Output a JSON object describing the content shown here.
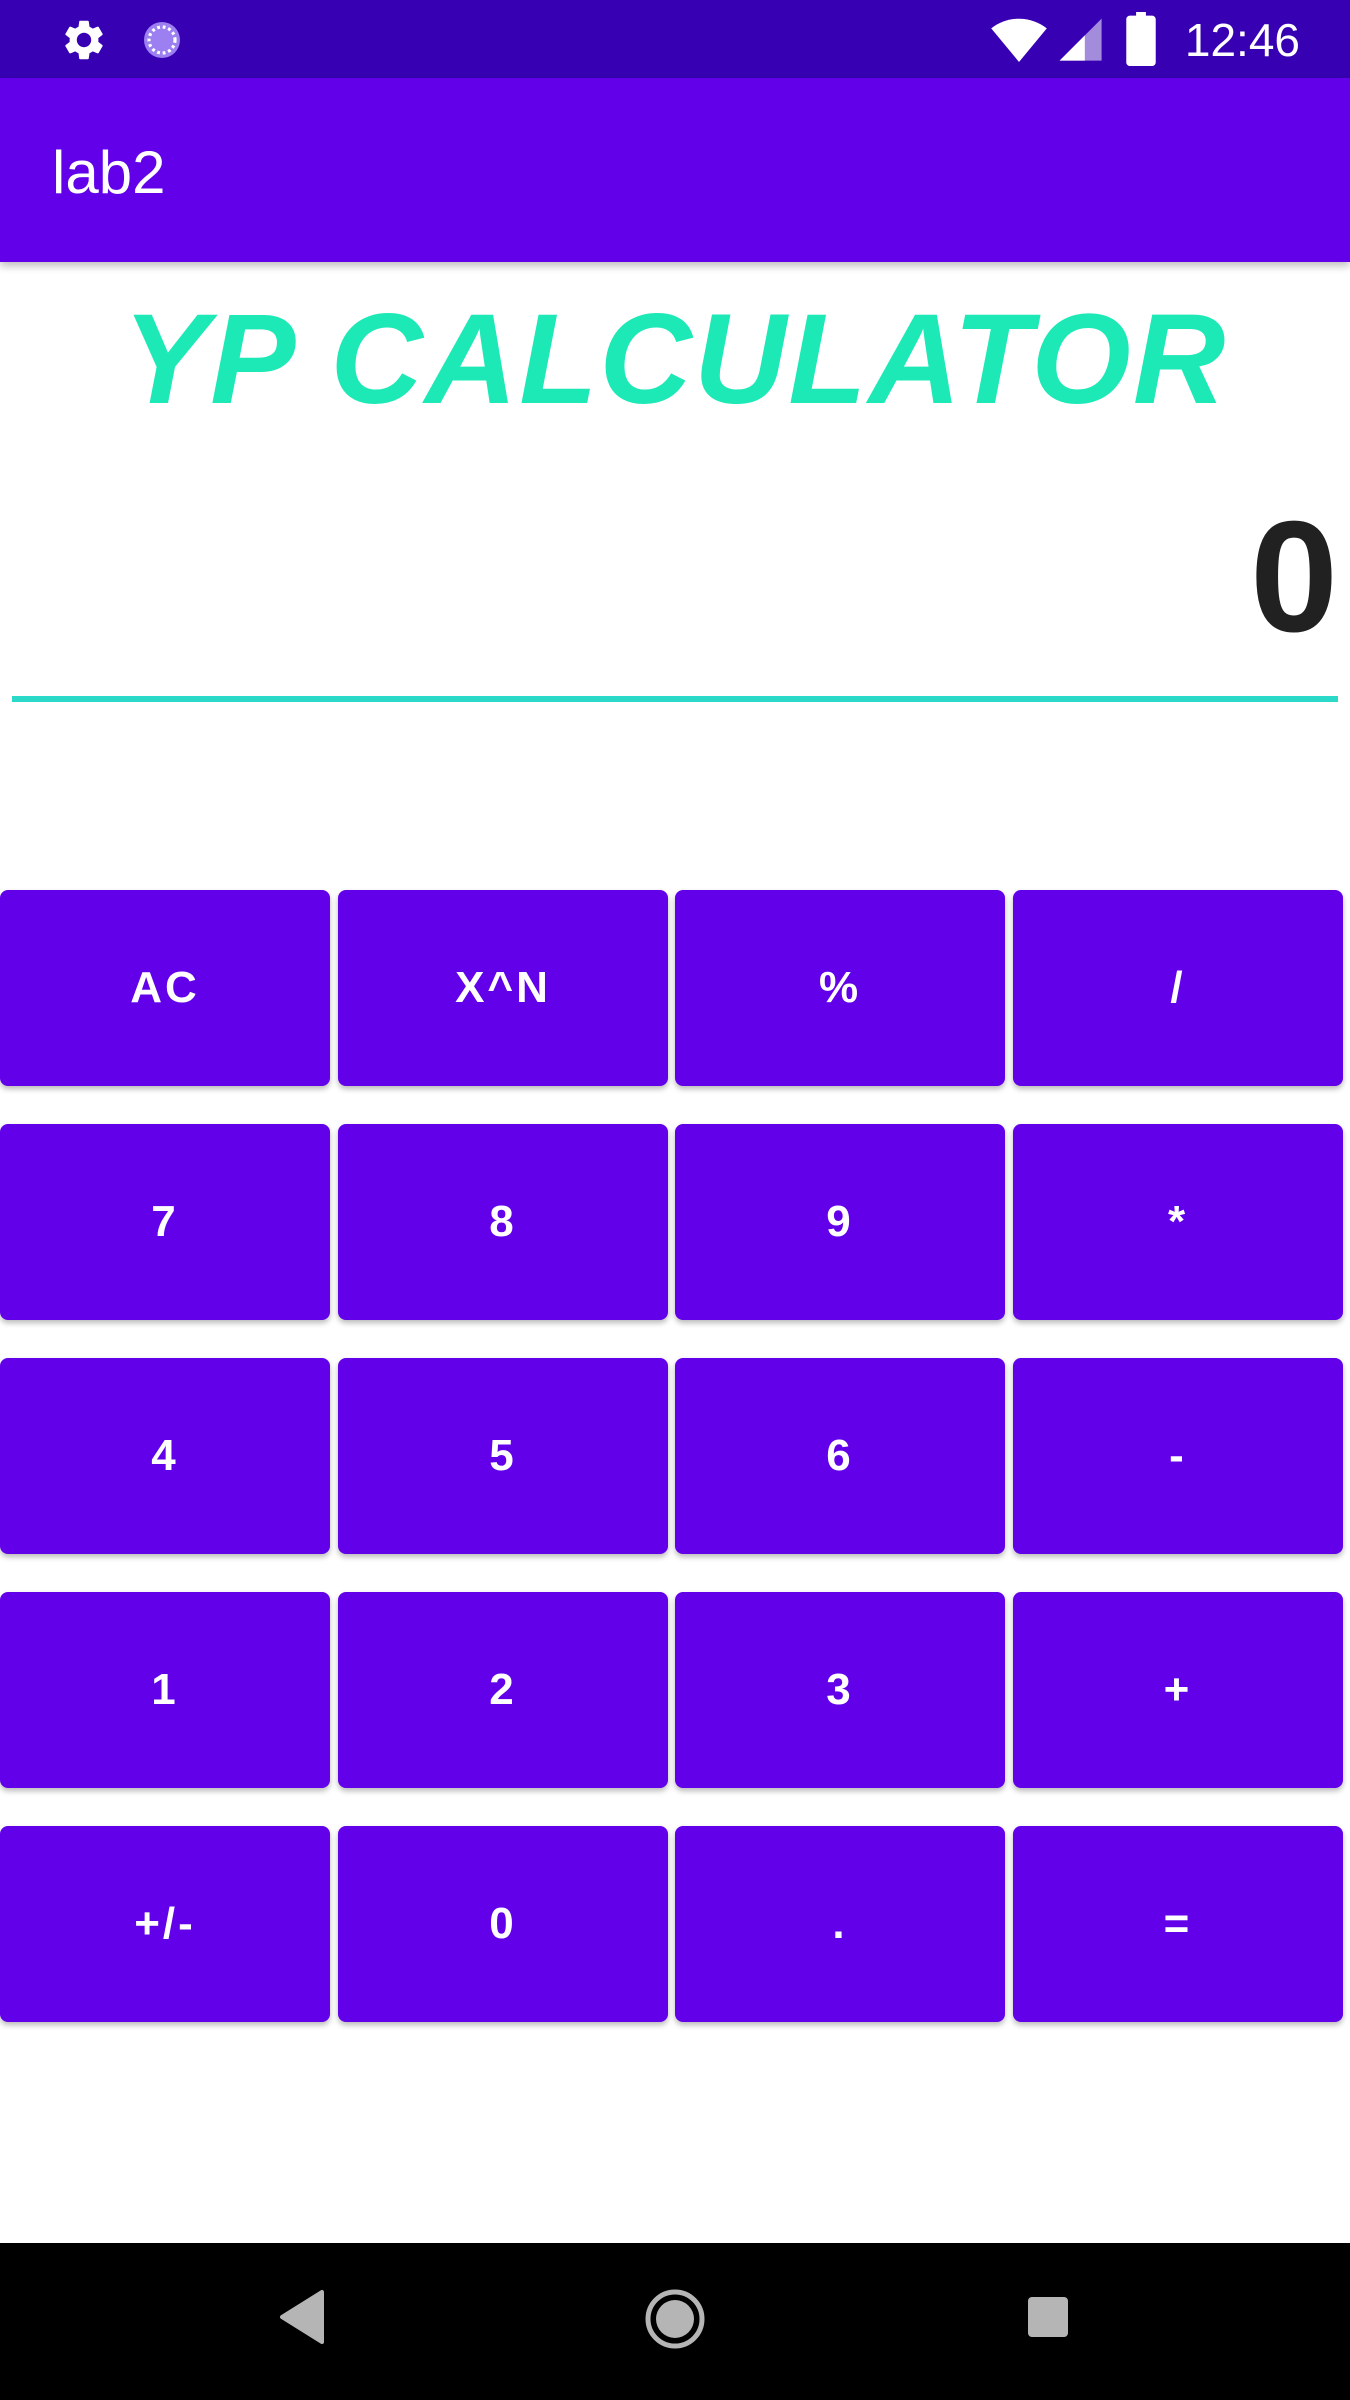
{
  "status_bar": {
    "time": "12:46",
    "icons": [
      "gear-icon",
      "sync-icon",
      "wifi-icon",
      "signal-icon",
      "battery-icon"
    ],
    "background": "#3700b3"
  },
  "app_bar": {
    "title": "lab2",
    "background": "#6200ea"
  },
  "headline": {
    "text": "YP CALCULATOR",
    "color": "#1de9b6"
  },
  "display": {
    "value": "0",
    "underline_color": "#2bd9c8"
  },
  "keypad": {
    "key_color": "#6200ea",
    "keys": [
      [
        "AC",
        "X^N",
        "%",
        "/"
      ],
      [
        "7",
        "8",
        "9",
        "*"
      ],
      [
        "4",
        "5",
        "6",
        "-"
      ],
      [
        "1",
        "2",
        "3",
        "+"
      ],
      [
        "+/-",
        "0",
        ".",
        "="
      ]
    ]
  },
  "nav_bar": {
    "buttons": [
      "back-icon",
      "home-icon",
      "recents-icon"
    ]
  }
}
